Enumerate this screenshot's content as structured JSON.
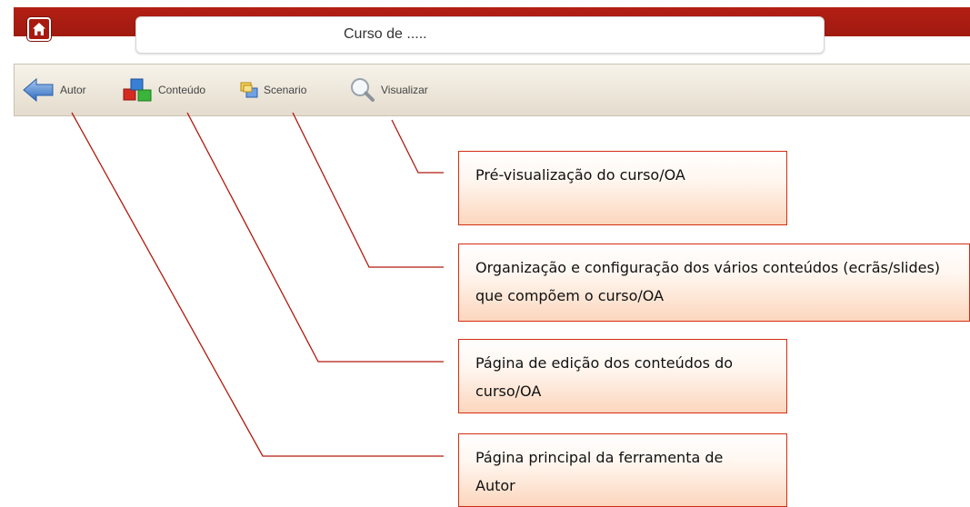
{
  "header": {
    "title": "Curso de .....",
    "home_icon": "home-icon"
  },
  "toolbar": {
    "items": [
      {
        "label": "Autor",
        "icon": "back-arrow-icon"
      },
      {
        "label": "Conteúdo",
        "icon": "cubes-icon"
      },
      {
        "label": "Scenario",
        "icon": "windows-icon"
      },
      {
        "label": "Visualizar",
        "icon": "magnifier-icon"
      }
    ]
  },
  "callouts": {
    "visualizar": "Pré-visualização do curso/OA",
    "scenario": "Organização e configuração dos vários conteúdos (ecrãs/slides) que compõem o curso/OA",
    "conteudo": "Página de edição dos conteúdos do curso/OA",
    "autor": "Página principal da ferramenta de Autor"
  },
  "colors": {
    "brand_red": "#a8190f",
    "callout_border": "#d32e12",
    "callout_fill": "#fcd6bd",
    "connector_line": "#b01a0e"
  }
}
